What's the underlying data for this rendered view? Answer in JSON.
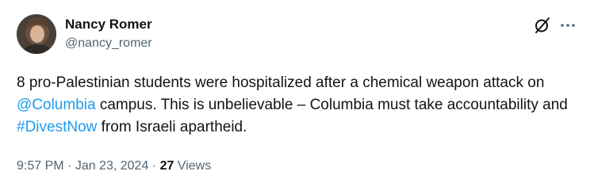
{
  "author": {
    "name": "Nancy Romer",
    "handle": "@nancy_romer"
  },
  "tweet": {
    "text_part1": "8 pro-Palestinian students were hospitalized after a chemical weapon attack on ",
    "mention": "@Columbia",
    "text_part2": " campus. This is unbelievable – Columbia must take accountability and ",
    "hashtag": "#DivestNow",
    "text_part3": " from Israeli apartheid."
  },
  "meta": {
    "time": "9:57 PM",
    "separator": " · ",
    "date": "Jan 23, 2024",
    "separator2": " · ",
    "views_count": "27",
    "views_label": " Views"
  },
  "icons": {
    "grok": "grok-icon",
    "more": "more-icon"
  },
  "colors": {
    "link": "#1d9bf0",
    "secondary_text": "#536471",
    "primary_text": "#0f1419"
  }
}
